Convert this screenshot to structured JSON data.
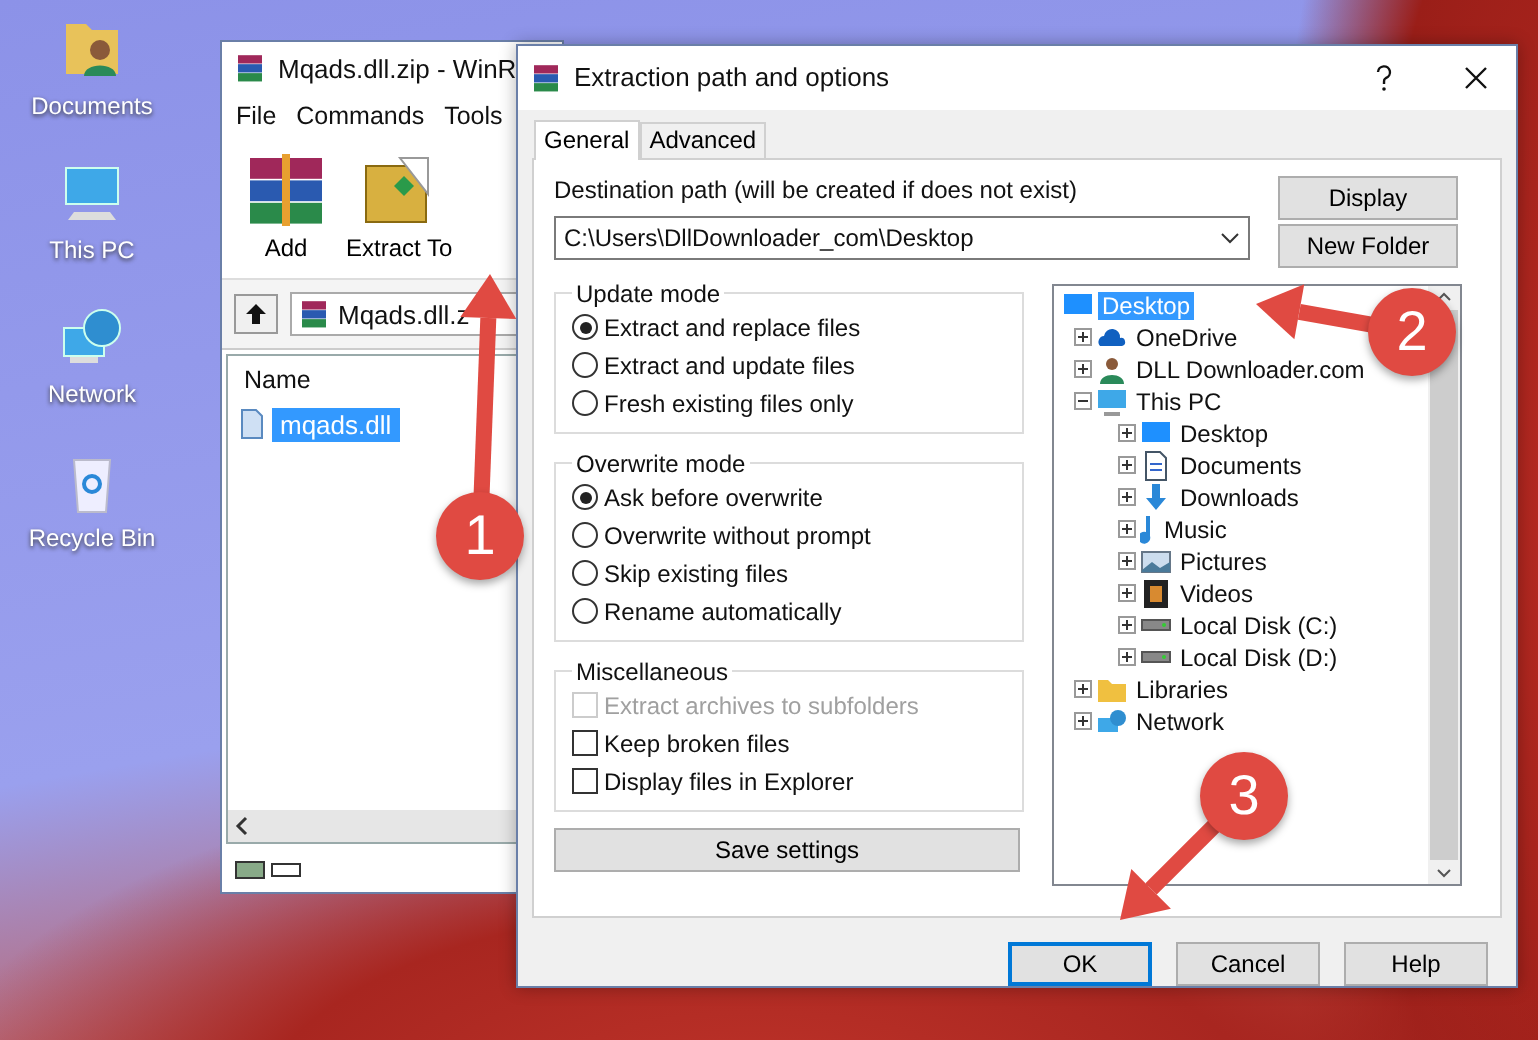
{
  "desktop_icons": [
    {
      "label": "Documents",
      "kind": "documents"
    },
    {
      "label": "This PC",
      "kind": "pc"
    },
    {
      "label": "Network",
      "kind": "network"
    },
    {
      "label": "Recycle Bin",
      "kind": "recycle"
    }
  ],
  "archive_window": {
    "title": "Mqads.dll.zip - WinR",
    "menu": [
      "File",
      "Commands",
      "Tools"
    ],
    "toolbar": [
      {
        "label": "Add",
        "kind": "add"
      },
      {
        "label": "Extract To",
        "kind": "extract"
      }
    ],
    "path": "Mqads.dll.z",
    "column": "Name",
    "files": [
      {
        "name": "mqads.dll",
        "selected": true
      }
    ]
  },
  "dialog": {
    "title": "Extraction path and options",
    "tabs": [
      {
        "label": "General",
        "selected": true
      },
      {
        "label": "Advanced",
        "selected": false
      }
    ],
    "destination_label": "Destination path (will be created if does not exist)",
    "destination_value": "C:\\Users\\DllDownloader_com\\Desktop",
    "side_buttons": [
      "Display",
      "New Folder"
    ],
    "groups": [
      {
        "title": "Update mode",
        "options": [
          {
            "label": "Extract and replace files",
            "kind": "radio",
            "selected": true
          },
          {
            "label": "Extract and update files",
            "kind": "radio",
            "selected": false
          },
          {
            "label": "Fresh existing files only",
            "kind": "radio",
            "selected": false
          }
        ]
      },
      {
        "title": "Overwrite mode",
        "options": [
          {
            "label": "Ask before overwrite",
            "kind": "radio",
            "selected": true
          },
          {
            "label": "Overwrite without prompt",
            "kind": "radio",
            "selected": false
          },
          {
            "label": "Skip existing files",
            "kind": "radio",
            "selected": false
          },
          {
            "label": "Rename automatically",
            "kind": "radio",
            "selected": false
          }
        ]
      },
      {
        "title": "Miscellaneous",
        "options": [
          {
            "label": "Extract archives to subfolders",
            "kind": "checkbox",
            "checked": false,
            "disabled": true
          },
          {
            "label": "Keep broken files",
            "kind": "checkbox",
            "checked": false,
            "disabled": false
          },
          {
            "label": "Display files in Explorer",
            "kind": "checkbox",
            "checked": false,
            "disabled": false
          }
        ]
      }
    ],
    "save_button": "Save settings",
    "tree": [
      {
        "label": "Desktop",
        "kind": "desktop",
        "selected": true,
        "children": [
          {
            "label": "OneDrive",
            "kind": "cloud",
            "selected": false,
            "expanded": false
          },
          {
            "label": "DLL Downloader.com",
            "kind": "user",
            "selected": false,
            "expanded": false
          },
          {
            "label": "This PC",
            "kind": "pc",
            "selected": false,
            "expanded": true,
            "children": [
              {
                "label": "Desktop",
                "kind": "desktop",
                "selected": false,
                "expanded": false
              },
              {
                "label": "Documents",
                "kind": "document",
                "selected": false,
                "expanded": false
              },
              {
                "label": "Downloads",
                "kind": "download",
                "selected": false,
                "expanded": false
              },
              {
                "label": "Music",
                "kind": "music",
                "selected": false,
                "expanded": false
              },
              {
                "label": "Pictures",
                "kind": "picture",
                "selected": false,
                "expanded": false
              },
              {
                "label": "Videos",
                "kind": "video",
                "selected": false,
                "expanded": false
              },
              {
                "label": "Local Disk (C:)",
                "kind": "disk",
                "selected": false,
                "expanded": false
              },
              {
                "label": "Local Disk (D:)",
                "kind": "disk",
                "selected": false,
                "expanded": false
              }
            ]
          },
          {
            "label": "Libraries",
            "kind": "library",
            "selected": false,
            "expanded": false
          },
          {
            "label": "Network",
            "kind": "network",
            "selected": false,
            "expanded": false
          }
        ]
      }
    ],
    "buttons": [
      {
        "label": "OK",
        "default": true
      },
      {
        "label": "Cancel",
        "default": false
      },
      {
        "label": "Help",
        "default": false
      }
    ]
  },
  "annotations": [
    {
      "number": "1"
    },
    {
      "number": "2"
    },
    {
      "number": "3"
    }
  ]
}
